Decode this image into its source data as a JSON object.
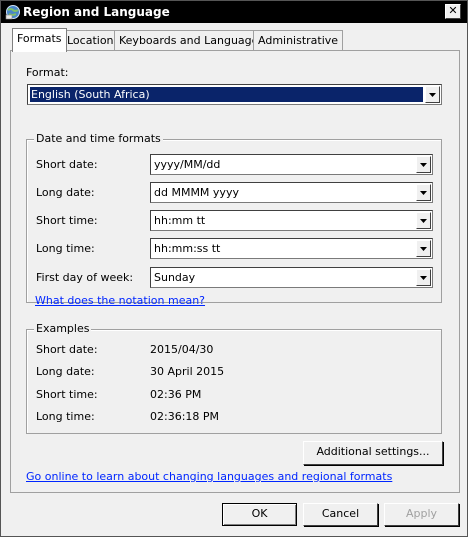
{
  "window": {
    "title": "Region and Language"
  },
  "tabs": [
    {
      "label": "Formats",
      "active": true
    },
    {
      "label": "Location"
    },
    {
      "label": "Keyboards and Languages"
    },
    {
      "label": "Administrative"
    }
  ],
  "format": {
    "label": "Format:",
    "value": "English (South Africa)"
  },
  "date_time": {
    "title": "Date and time formats",
    "rows": [
      {
        "label": "Short date:",
        "value": "yyyy/MM/dd"
      },
      {
        "label": "Long date:",
        "value": "dd MMMM yyyy"
      },
      {
        "label": "Short time:",
        "value": "hh:mm tt"
      },
      {
        "label": "Long time:",
        "value": "hh:mm:ss tt"
      },
      {
        "label": "First day of week:",
        "value": "Sunday"
      }
    ],
    "notation_link": "What does the notation mean?"
  },
  "examples": {
    "title": "Examples",
    "rows": [
      {
        "label": "Short date:",
        "value": "2015/04/30"
      },
      {
        "label": "Long date:",
        "value": "30 April 2015"
      },
      {
        "label": "Short time:",
        "value": "02:36 PM"
      },
      {
        "label": "Long time:",
        "value": "02:36:18 PM"
      }
    ]
  },
  "additional_settings_label": "Additional settings...",
  "online_link": "Go online to learn about changing languages and regional formats",
  "buttons": {
    "ok": "OK",
    "cancel": "Cancel",
    "apply": "Apply"
  },
  "close_glyph": "✕"
}
